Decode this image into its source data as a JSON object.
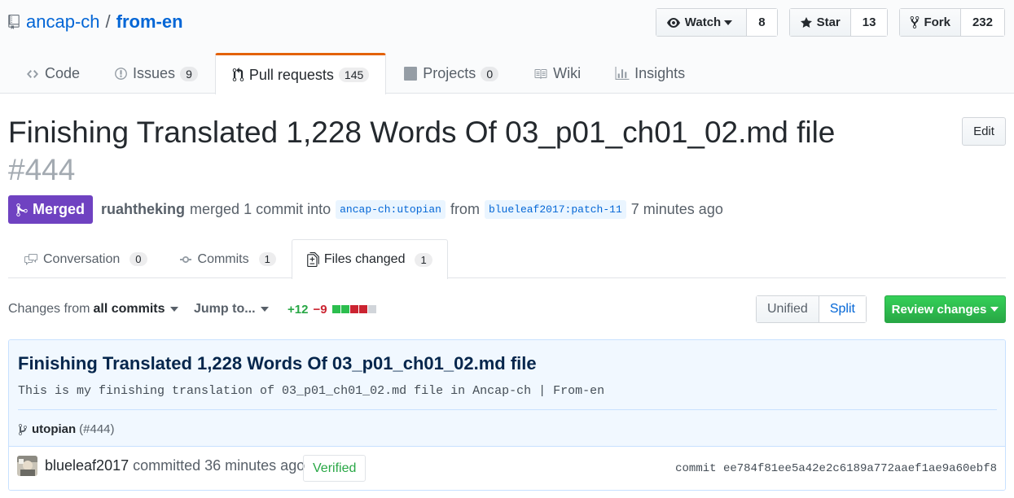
{
  "repo": {
    "owner": "ancap-ch",
    "separator": "/",
    "name": "from-en",
    "watch": {
      "label": "Watch",
      "count": "8"
    },
    "star": {
      "label": "Star",
      "count": "13"
    },
    "fork": {
      "label": "Fork",
      "count": "232"
    }
  },
  "reponav": [
    {
      "label": "Code",
      "icon": "code-icon"
    },
    {
      "label": "Issues",
      "count": "9",
      "icon": "issue-icon"
    },
    {
      "label": "Pull requests",
      "count": "145",
      "icon": "pull-request-icon"
    },
    {
      "label": "Projects",
      "count": "0",
      "icon": "project-icon"
    },
    {
      "label": "Wiki",
      "icon": "book-icon"
    },
    {
      "label": "Insights",
      "icon": "graph-icon"
    }
  ],
  "pr": {
    "title": "Finishing Translated 1,228 Words Of 03_p01_ch01_02.md file",
    "number": "#444",
    "edit_label": "Edit",
    "state": "Merged",
    "author": "ruahtheking",
    "merged_text": "merged 1 commit into",
    "base_branch": "ancap-ch:utopian",
    "from_text": "from",
    "head_branch": "blueleaf2017:patch-11",
    "time": "7 minutes ago"
  },
  "tabs": [
    {
      "label": "Conversation",
      "count": "0",
      "icon": "comment-discussion-icon"
    },
    {
      "label": "Commits",
      "count": "1",
      "icon": "commit-icon"
    },
    {
      "label": "Files changed",
      "count": "1",
      "icon": "file-diff-icon"
    }
  ],
  "toolbar": {
    "changes_from": "Changes from",
    "all_commits": "all commits",
    "jump_to": "Jump to...",
    "additions": "+12",
    "deletions": "−9",
    "unified": "Unified",
    "split": "Split",
    "review": "Review changes"
  },
  "commit": {
    "title": "Finishing Translated 1,228 Words Of 03_p01_ch01_02.md file",
    "description": "This is my finishing translation of 03_p01_ch01_02.md file in Ancap-ch | From-en",
    "branch": "utopian",
    "pr_ref": "(#444)",
    "author": "blueleaf2017",
    "committed_text": "committed 36 minutes ago",
    "verified": "Verified",
    "sha_label": "commit",
    "sha": "ee784f81ee5a42e2c6189a772aaef1ae9a60ebf8"
  },
  "colors": {
    "merged": "#6f42c1",
    "link": "#0366d6",
    "additions": "#28a745",
    "deletions": "#cb2431",
    "tab_accent": "#e36209"
  }
}
